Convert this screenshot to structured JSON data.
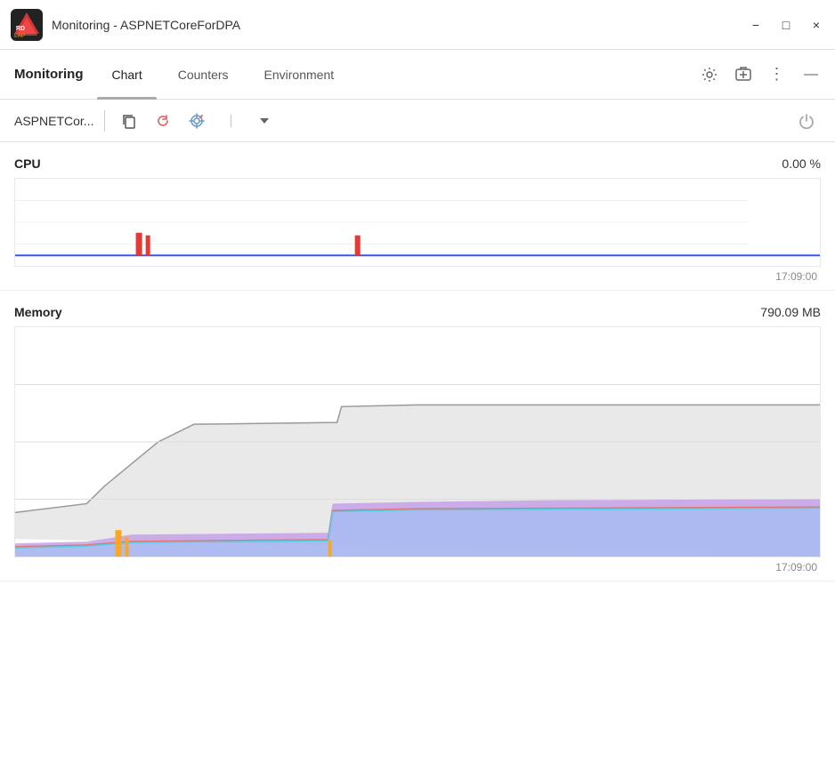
{
  "window": {
    "title": "Monitoring - ASPNETCoreForDPA",
    "logo_text": "RD EAP"
  },
  "title_bar": {
    "minimize_label": "−",
    "maximize_label": "□",
    "close_label": "×"
  },
  "tabs": {
    "main_label": "Monitoring",
    "items": [
      {
        "id": "chart",
        "label": "Chart",
        "active": true
      },
      {
        "id": "counters",
        "label": "Counters",
        "active": false
      },
      {
        "id": "environment",
        "label": "Environment",
        "active": false
      }
    ]
  },
  "toolbar": {
    "app_name": "ASPNETCor...",
    "icons": {
      "copy": "⧉",
      "refresh": "↺",
      "target": "⊕",
      "chevron": "▾"
    }
  },
  "charts": {
    "cpu": {
      "title": "CPU",
      "value": "0.00 %",
      "timestamp": "17:09:00"
    },
    "memory": {
      "title": "Memory",
      "value": "790.09 MB",
      "timestamp": "17:09:00"
    }
  }
}
